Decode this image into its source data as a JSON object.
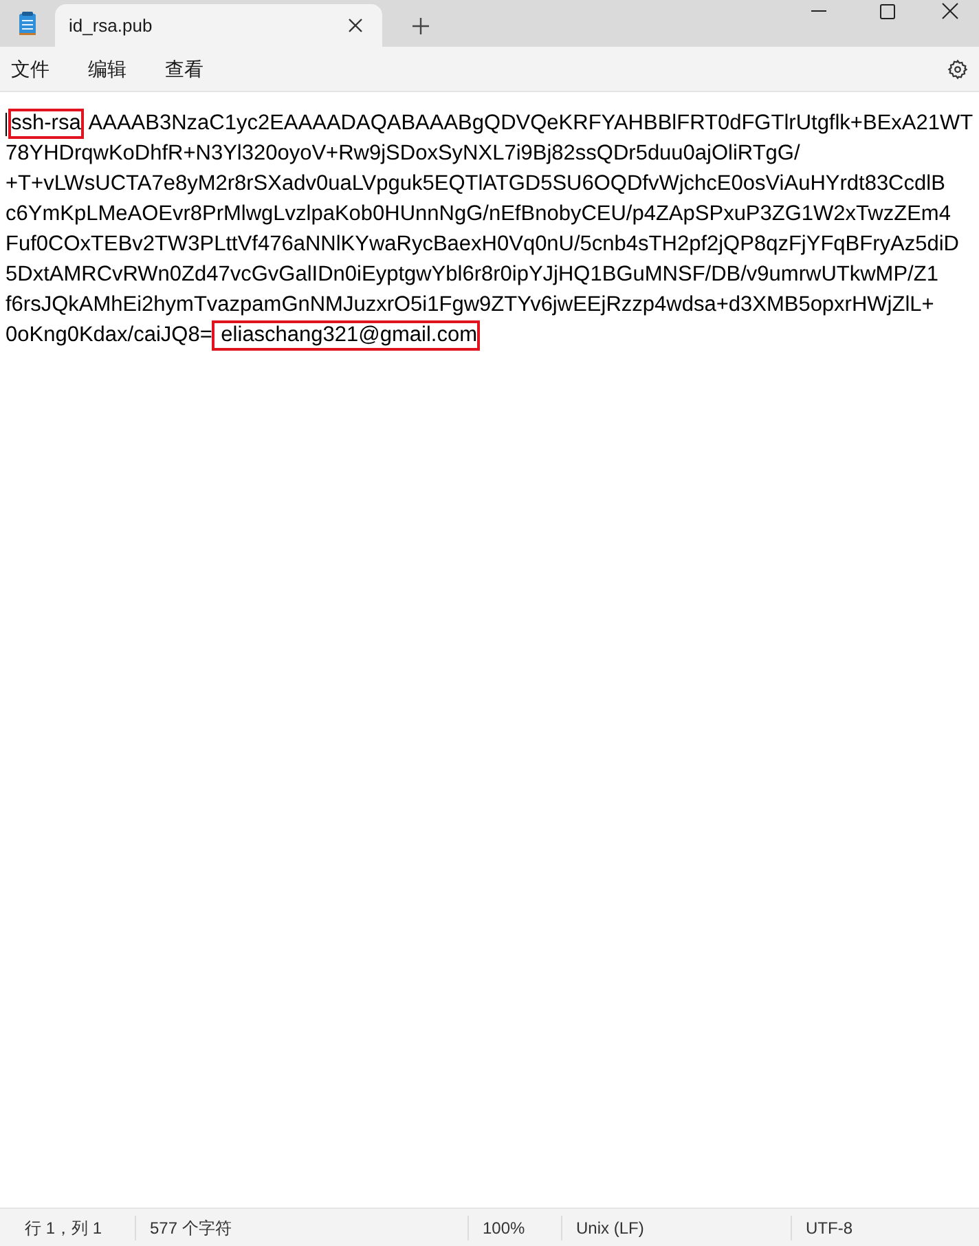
{
  "tabs": [
    {
      "label": "id_rsa.pub",
      "selected": true
    }
  ],
  "menu": [
    "文件",
    "编辑",
    "查看"
  ],
  "editor": {
    "cursor_at_start": true,
    "lines": [
      [
        {
          "text": "ssh-rsa",
          "highlighted": true
        },
        {
          "text": " AAAAB3NzaC1yc2EAAAADAQABAAABgQDVQeKRFYAHBBlFRT0dFGTlrUtgflk+BExA21WT",
          "highlighted": false
        }
      ],
      [
        {
          "text": "78YHDrqwKoDhfR+N3Yl320oyoV+Rw9jSDoxSyNXL7i9Bj82ssQDr5duu0ajOliRTgG/",
          "highlighted": false
        }
      ],
      [
        {
          "text": "+T+vLWsUCTA7e8yM2r8rSXadv0uaLVpguk5EQTlATGD5SU6OQDfvWjchcE0osViAuHYrdt83CcdlB",
          "highlighted": false
        }
      ],
      [
        {
          "text": "c6YmKpLMeAOEvr8PrMlwgLvzlpaKob0HUnnNgG/nEfBnobyCEU/p4ZApSPxuP3ZG1W2xTwzZEm4",
          "highlighted": false
        }
      ],
      [
        {
          "text": "Fuf0COxTEBv2TW3PLttVf476aNNlKYwaRycBaexH0Vq0nU/5cnb4sTH2pf2jQP8qzFjYFqBFryAz5diD",
          "highlighted": false
        }
      ],
      [
        {
          "text": "5DxtAMRCvRWn0Zd47vcGvGalIDn0iEyptgwYbl6r8r0ipYJjHQ1BGuMNSF/DB/v9umrwUTkwMP/Z1",
          "highlighted": false
        }
      ],
      [
        {
          "text": "f6rsJQkAMhEi2hymTvazpamGnNMJuzxrO5i1Fgw9ZTYv6jwEEjRzzp4wdsa+d3XMB5opxrHWjZlL+",
          "highlighted": false
        }
      ],
      [
        {
          "text": "0oKng0Kdax/caiJQ8=",
          "highlighted": false
        },
        {
          "text": " eliaschang321@gmail.com",
          "highlighted": true
        }
      ]
    ]
  },
  "status_bar": [
    "行 1，列 1",
    "577 个字符",
    "100%",
    "Unix (LF)",
    "UTF-8"
  ]
}
